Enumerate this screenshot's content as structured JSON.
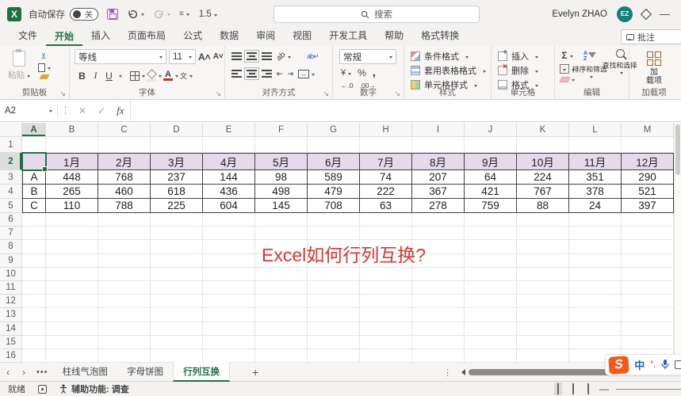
{
  "titlebar": {
    "autosave_label": "自动保存",
    "autosave_state": "关",
    "qat_zoom": "1.5",
    "search_placeholder": "搜索",
    "user_name": "Evelyn ZHAO",
    "user_initials": "EZ"
  },
  "ribbon_tabs": {
    "items": [
      "文件",
      "开始",
      "插入",
      "页面布局",
      "公式",
      "数据",
      "审阅",
      "视图",
      "开发工具",
      "帮助",
      "格式转换"
    ],
    "active": "开始",
    "comments_label": "批注"
  },
  "ribbon": {
    "clipboard": {
      "label": "剪贴板",
      "paste": "粘贴"
    },
    "font": {
      "label": "字体",
      "font_name": "等线",
      "font_size": "11",
      "bold": "B",
      "italic": "I",
      "underline": "U",
      "grow": "A^",
      "shrink": "A˅",
      "phonetic": "文"
    },
    "alignment": {
      "label": "对齐方式",
      "wrap": "ab",
      "orientation": "ab"
    },
    "number": {
      "label": "数字",
      "format": "常规",
      "currency": "¥",
      "percent": "%",
      "comma": ",",
      "dec_inc": "←.0",
      "dec_dec": ".00→"
    },
    "styles": {
      "label": "样式",
      "items": [
        "条件格式",
        "套用表格格式",
        "单元格样式"
      ]
    },
    "cells": {
      "label": "单元格",
      "items": [
        "插入",
        "删除",
        "格式"
      ]
    },
    "editing": {
      "label": "编辑",
      "sum": "Σ",
      "sort": "排序和筛选",
      "find": "查找和选择"
    },
    "addins": {
      "label": "加载项",
      "button_line1": "加",
      "button_line2": "载项"
    }
  },
  "formula_bar": {
    "name_box": "A2",
    "fx": "fx",
    "formula": ""
  },
  "sheet": {
    "columns": [
      "A",
      "B",
      "C",
      "D",
      "E",
      "F",
      "G",
      "H",
      "I",
      "J",
      "K",
      "L",
      "M"
    ],
    "selected_cell": "A2",
    "months": [
      "1月",
      "2月",
      "3月",
      "4月",
      "5月",
      "6月",
      "7月",
      "8月",
      "9月",
      "10月",
      "11月",
      "12月"
    ],
    "rows": [
      {
        "label": "A",
        "values": [
          448,
          768,
          237,
          144,
          98,
          589,
          74,
          207,
          64,
          224,
          351,
          290
        ]
      },
      {
        "label": "B",
        "values": [
          265,
          460,
          618,
          436,
          498,
          479,
          222,
          367,
          421,
          767,
          378,
          521
        ]
      },
      {
        "label": "C",
        "values": [
          110,
          788,
          225,
          604,
          145,
          708,
          63,
          278,
          759,
          88,
          24,
          397
        ]
      }
    ],
    "overlay_title": {
      "text": "Excel如何行列互换?",
      "color": "#D93831"
    }
  },
  "sheet_tabs": {
    "tabs": [
      "柱线气泡图",
      "字母饼图",
      "行列互换"
    ],
    "active": "行列互换",
    "add": "+"
  },
  "ime": {
    "lang": "中",
    "symbols": "°,"
  },
  "status_bar": {
    "ready": "就绪",
    "accessibility": "辅助功能: 调查"
  },
  "colors": {
    "accent_green": "#1E7145",
    "header_fill": "#E6D9EC",
    "title_red": "#D93831",
    "avatar_teal": "#15817A",
    "sogou_orange": "#F4581C"
  }
}
